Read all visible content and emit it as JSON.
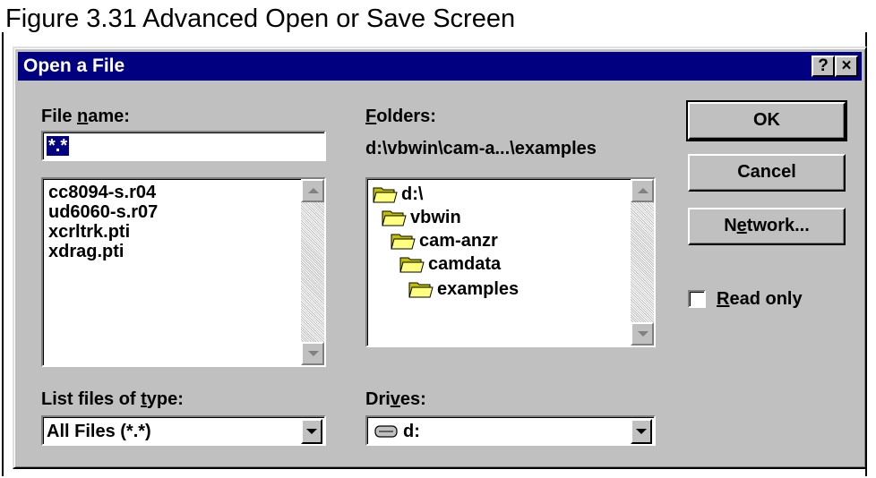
{
  "caption": "Figure 3.31  Advanced Open or Save Screen",
  "dialog": {
    "title": "Open a File",
    "help_button": "?",
    "close_button": "×"
  },
  "file_name": {
    "label_pre": "File ",
    "label_accel": "n",
    "label_post": "ame:",
    "value": "*.*"
  },
  "files": [
    "cc8094-s.r04",
    "ud6060-s.r07",
    "xcrltrk.pti",
    "xdrag.pti"
  ],
  "folders": {
    "label_accel": "F",
    "label_post": "olders:",
    "current_path": "d:\\vbwin\\cam-a...\\examples",
    "tree": [
      {
        "name": "d:\\",
        "icon": "open-folder-icon"
      },
      {
        "name": "vbwin",
        "icon": "open-folder-icon"
      },
      {
        "name": "cam-anzr",
        "icon": "open-folder-icon"
      },
      {
        "name": "camdata",
        "icon": "open-folder-icon"
      },
      {
        "name": "examples",
        "icon": "open-folder-icon"
      }
    ]
  },
  "file_type": {
    "label_pre": "List files of ",
    "label_accel": "t",
    "label_post": "ype:",
    "selected": "All Files (*.*)"
  },
  "drives": {
    "label_pre": "Dri",
    "label_accel": "v",
    "label_post": "es:",
    "selected": "d:",
    "icon": "drive-icon"
  },
  "buttons": {
    "ok": "OK",
    "cancel": "Cancel",
    "network_pre": "N",
    "network_accel": "e",
    "network_post": "twork..."
  },
  "read_only": {
    "label_accel": "R",
    "label_post": "ead only",
    "checked": false
  },
  "colors": {
    "titlebar": "#000080",
    "face": "#c0c0c0",
    "selection": "#000080"
  }
}
